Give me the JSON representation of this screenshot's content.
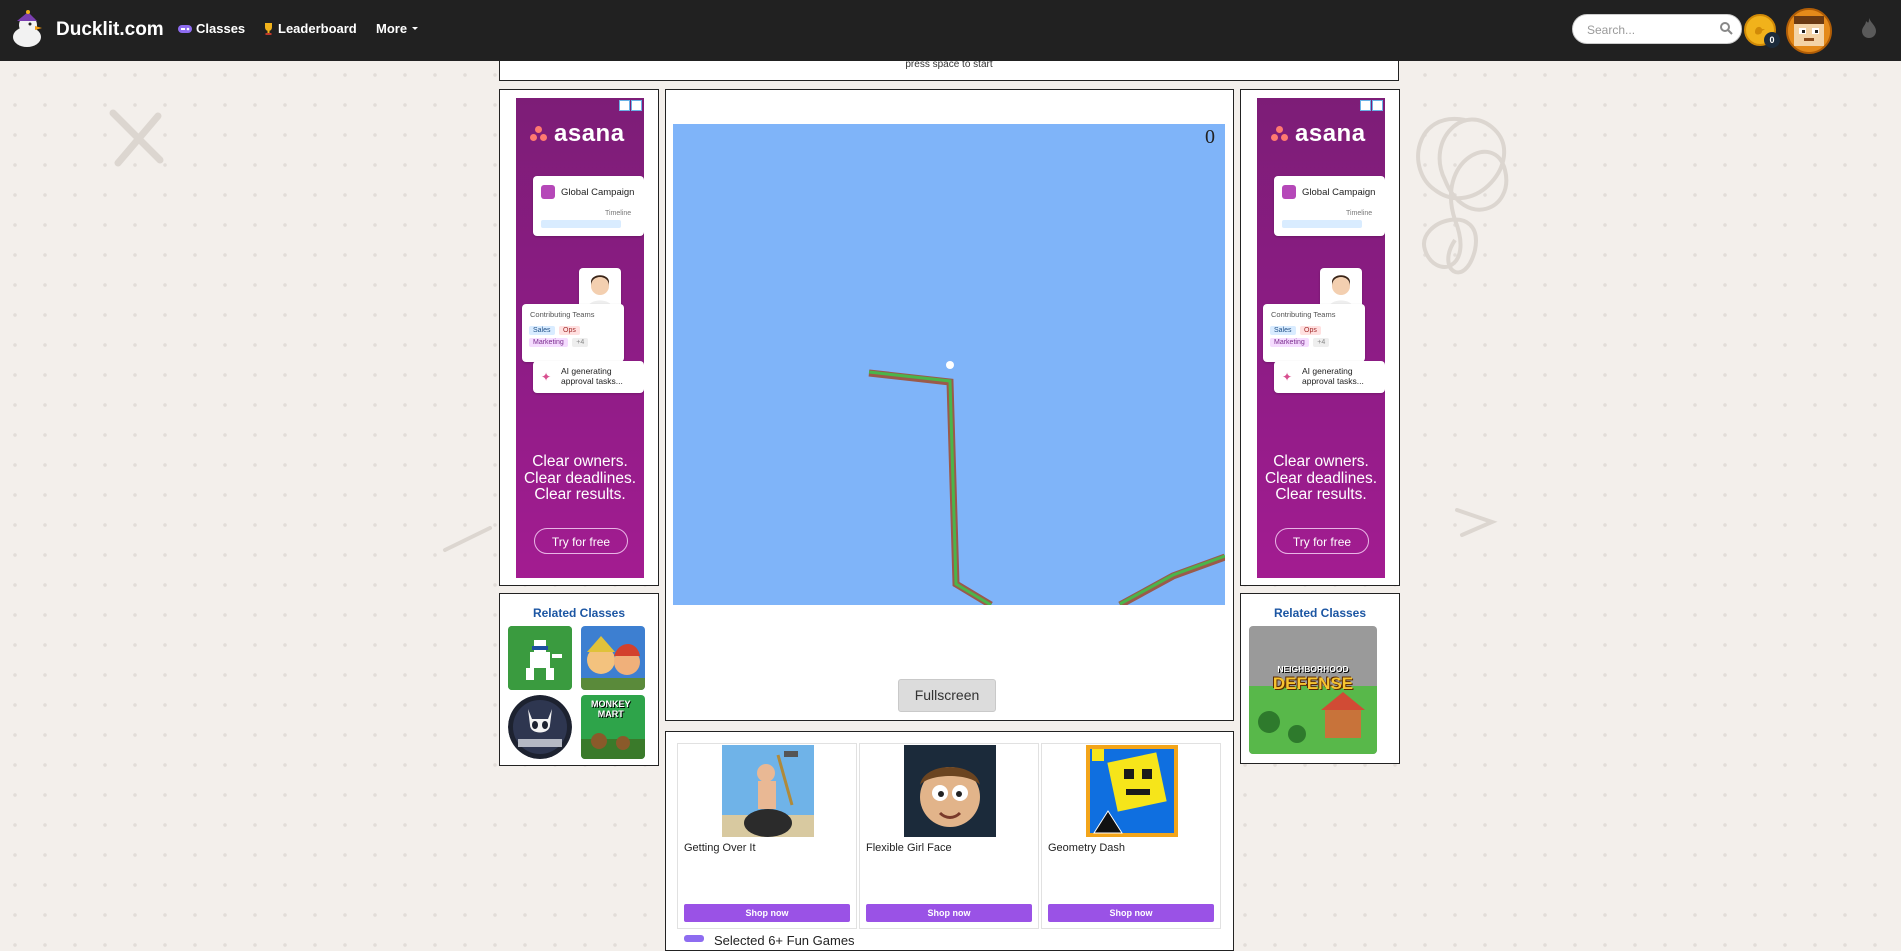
{
  "nav": {
    "brand": "Ducklit.com",
    "items": [
      {
        "label": "Classes",
        "icon": "gamepad-icon"
      },
      {
        "label": "Leaderboard",
        "icon": "trophy-icon"
      },
      {
        "label": "More",
        "icon": "caret-down-icon"
      }
    ],
    "search_placeholder": "Search...",
    "coins": "0"
  },
  "top_strip": {
    "text": "press space to start"
  },
  "ads": {
    "brand": "asana",
    "card_title": "Global Campaign",
    "timeline_label": "Timeline",
    "teams_label": "Contributing Teams",
    "chips": [
      "Sales",
      "Ops",
      "Marketing",
      "+4"
    ],
    "ai_text": "AI generating approval tasks...",
    "copy_lines": [
      "Clear owners.",
      "Clear deadlines.",
      "Clear results."
    ],
    "cta": "Try for free"
  },
  "related": {
    "left_title": "Related Classes",
    "right_title": "Related Classes",
    "right_game_lines": [
      "NEIGHBORHOOD",
      "DEFENSE"
    ],
    "monkey_mart_lines": [
      "MONKEY",
      "MART"
    ]
  },
  "game": {
    "score": "0",
    "fullscreen_label": "Fullscreen"
  },
  "shop": {
    "items": [
      {
        "name": "Getting Over It",
        "button": "Shop now"
      },
      {
        "name": "Flexible Girl Face",
        "button": "Shop now"
      },
      {
        "name": "Geometry Dash",
        "button": "Shop now"
      }
    ],
    "selected_label": "Selected 6+ Fun Games"
  },
  "colors": {
    "nav_bg": "#212121",
    "game_sky": "#7fb4f9",
    "track_green": "#4ab54a",
    "shop_button": "#9a52e6",
    "ad_purple": "#8e1c86"
  }
}
